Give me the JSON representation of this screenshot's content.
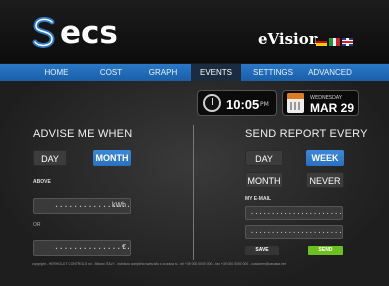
{
  "header": {
    "logo_text": "ecs",
    "brand": "eVision",
    "languages": [
      "german-flag",
      "italian-flag",
      "uk-flag"
    ]
  },
  "nav": {
    "items": [
      {
        "label": "HOME"
      },
      {
        "label": "COST"
      },
      {
        "label": "GRAPH"
      },
      {
        "label": "EVENTS"
      },
      {
        "label": "SETTINGS"
      },
      {
        "label": "ADVANCED"
      }
    ],
    "active": "EVENTS",
    "accent_color": "#2a78c8"
  },
  "clock": {
    "time": "10:05",
    "ampm": "PM",
    "weekday": "WEDNESDAY",
    "date": "MAR 29"
  },
  "advise": {
    "title": "ADVISE ME WHEN",
    "day_label": "DAY",
    "month_label": "MONTH",
    "selected": "MONTH",
    "above_label": "ABOVE",
    "above_value": ".................",
    "above_unit": "kWh",
    "or_label": "OR",
    "cost_value": "...................",
    "cost_unit": "€"
  },
  "report": {
    "title": "SEND REPORT EVERY",
    "day_label": "DAY",
    "week_label": "WEEK",
    "month_label": "MONTH",
    "never_label": "NEVER",
    "selected": "WEEK",
    "email_label": "MY E-MAIL",
    "email1": "..........................@..........",
    "email2": "..........................@..........",
    "save_label": "SAVE",
    "send_label": "SEND"
  },
  "footer": {
    "text": "copyright - HERHOLDT CONTROLS srl - Milano ITALY - indirizzo completo www.sito o a oraca si - tel +39 000 0000 000 - fax +39 000 0000 000 - customer@casasia.net"
  }
}
